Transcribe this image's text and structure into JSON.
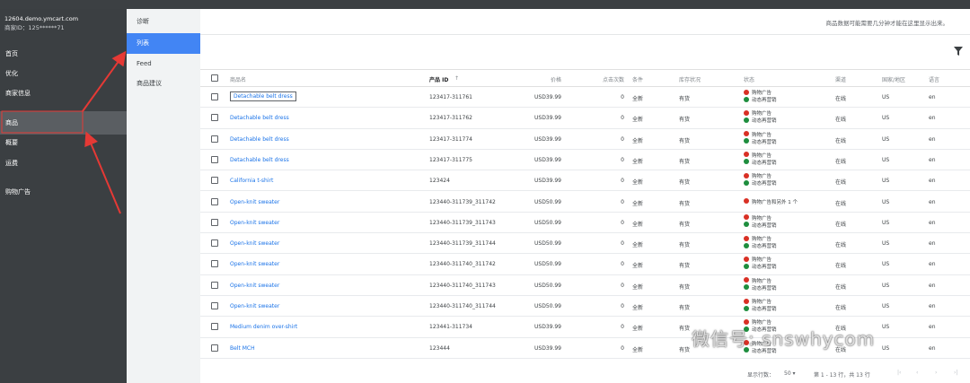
{
  "account": {
    "domain": "12604.demo.ymcart.com",
    "id": "商家ID：125******71"
  },
  "sidebar": {
    "items": [
      {
        "label": "首页"
      },
      {
        "label": "优化"
      },
      {
        "label": "商家信息"
      },
      {
        "label": "商品"
      },
      {
        "label": "概要"
      },
      {
        "label": "运费"
      },
      {
        "label": "购物广告"
      }
    ]
  },
  "subnav": {
    "items": [
      {
        "label": "诊断"
      },
      {
        "label": "列表"
      },
      {
        "label": "Feed"
      },
      {
        "label": "商品建议"
      }
    ]
  },
  "banner": "商品数据可能需要几分钟才能在这里显示出来。",
  "table": {
    "headers": [
      "商品名",
      "产品 ID",
      "↑",
      "价格",
      "点击次数",
      "条件",
      "库存状况",
      "状态",
      "渠道",
      "国家/地区",
      "语言"
    ],
    "rows": [
      {
        "title": "Detachable belt dress",
        "id": "123417-311761",
        "price": "USD39.99",
        "clicks": "0",
        "cond": "全新",
        "stock": "有货",
        "status": [
          "购物广告",
          "动态再营销"
        ],
        "channel": "在线",
        "country": "US",
        "lang": "en"
      },
      {
        "title": "Detachable belt dress",
        "id": "123417-311762",
        "price": "USD39.99",
        "clicks": "0",
        "cond": "全新",
        "stock": "有货",
        "status": [
          "购物广告",
          "动态再营销"
        ],
        "channel": "在线",
        "country": "US",
        "lang": "en"
      },
      {
        "title": "Detachable belt dress",
        "id": "123417-311774",
        "price": "USD39.99",
        "clicks": "0",
        "cond": "全新",
        "stock": "有货",
        "status": [
          "购物广告",
          "动态再营销"
        ],
        "channel": "在线",
        "country": "US",
        "lang": "en"
      },
      {
        "title": "Detachable belt dress",
        "id": "123417-311775",
        "price": "USD39.99",
        "clicks": "0",
        "cond": "全新",
        "stock": "有货",
        "status": [
          "购物广告",
          "动态再营销"
        ],
        "channel": "在线",
        "country": "US",
        "lang": "en"
      },
      {
        "title": "California t-shirt",
        "id": "123424",
        "price": "USD39.99",
        "clicks": "0",
        "cond": "全新",
        "stock": "有货",
        "status": [
          "购物广告",
          "动态再营销"
        ],
        "channel": "在线",
        "country": "US",
        "lang": "en"
      },
      {
        "title": "Open-knit sweater",
        "id": "123440-311739_311742",
        "price": "USD50.99",
        "clicks": "0",
        "cond": "全新",
        "stock": "有货",
        "status": [
          "购物广告和另外 1 个"
        ],
        "channel": "在线",
        "country": "US",
        "lang": "en"
      },
      {
        "title": "Open-knit sweater",
        "id": "123440-311739_311743",
        "price": "USD50.99",
        "clicks": "0",
        "cond": "全新",
        "stock": "有货",
        "status": [
          "购物广告",
          "动态再营销"
        ],
        "channel": "在线",
        "country": "US",
        "lang": "en"
      },
      {
        "title": "Open-knit sweater",
        "id": "123440-311739_311744",
        "price": "USD50.99",
        "clicks": "0",
        "cond": "全新",
        "stock": "有货",
        "status": [
          "购物广告",
          "动态再营销"
        ],
        "channel": "在线",
        "country": "US",
        "lang": "en"
      },
      {
        "title": "Open-knit sweater",
        "id": "123440-311740_311742",
        "price": "USD50.99",
        "clicks": "0",
        "cond": "全新",
        "stock": "有货",
        "status": [
          "购物广告",
          "动态再营销"
        ],
        "channel": "在线",
        "country": "US",
        "lang": "en"
      },
      {
        "title": "Open-knit sweater",
        "id": "123440-311740_311743",
        "price": "USD50.99",
        "clicks": "0",
        "cond": "全新",
        "stock": "有货",
        "status": [
          "购物广告",
          "动态再营销"
        ],
        "channel": "在线",
        "country": "US",
        "lang": "en"
      },
      {
        "title": "Open-knit sweater",
        "id": "123440-311740_311744",
        "price": "USD50.99",
        "clicks": "0",
        "cond": "全新",
        "stock": "有货",
        "status": [
          "购物广告",
          "动态再营销"
        ],
        "channel": "在线",
        "country": "US",
        "lang": "en"
      },
      {
        "title": "Medium denim over-shirt",
        "id": "123441-311734",
        "price": "USD39.99",
        "clicks": "0",
        "cond": "全新",
        "stock": "有货",
        "status": [
          "购物广告",
          "动态再营销"
        ],
        "channel": "在线",
        "country": "US",
        "lang": "en"
      },
      {
        "title": "Belt MCH",
        "id": "123444",
        "price": "USD39.99",
        "clicks": "0",
        "cond": "全新",
        "stock": "有货",
        "status": [
          "购物广告",
          "动态再营销"
        ],
        "channel": "在线",
        "country": "US",
        "lang": "en"
      }
    ]
  },
  "footer": {
    "rows_label": "显示行数：",
    "rows_value": "50",
    "range": "第 1 - 13 行，共 13 行"
  },
  "watermark": "微信号: snswhycom"
}
